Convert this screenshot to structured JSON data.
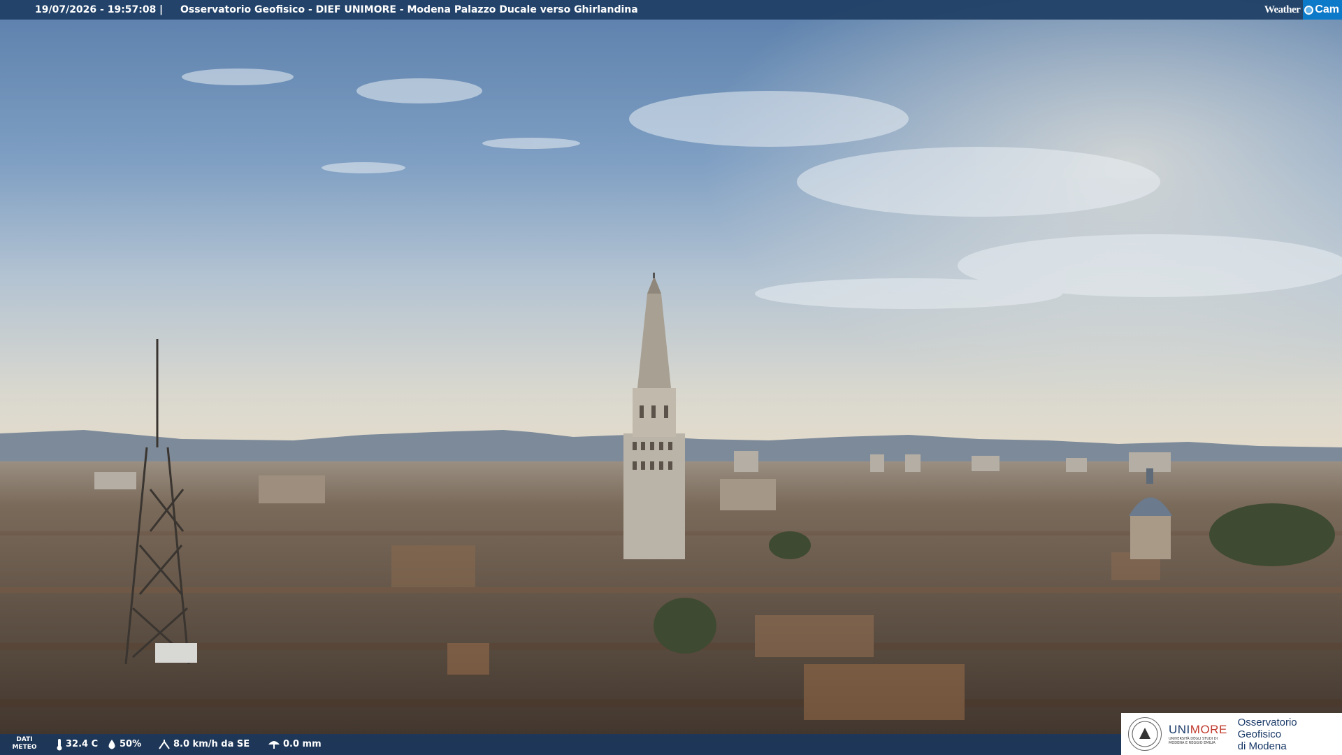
{
  "header": {
    "timestamp": "19/07/2026 - 19:57:08",
    "separator": "|",
    "title": "Osservatorio Geofisico - DIEF UNIMORE - Modena Palazzo Ducale verso Ghirlandina",
    "logo_word": "Weather",
    "logo_cam": "Cam"
  },
  "weather": {
    "label_line1": "DATI",
    "label_line2": "METEO",
    "temperature": "32.4 C",
    "humidity": "50%",
    "wind": "8.0 km/h da SE",
    "rain": "0.0 mm"
  },
  "footer_logo": {
    "brand_a": "UNI",
    "brand_b": "MORE",
    "brand_sub": "UNIVERSITÀ DEGLI STUDI DI MODENA E REGGIO EMILIA",
    "observatory_line1": "Osservatorio Geofisico",
    "observatory_line2": "di Modena"
  },
  "scene": {
    "subject": "view over Modena rooftops toward the Ghirlandina tower at sunset",
    "colors": {
      "sky_top": "#5a7fab",
      "sky_mid": "#9fb8d0",
      "sky_horizon": "#e2ddd0",
      "roofs": "#5a4a3e",
      "tower": "#b9b2a6",
      "bar": "#1e3e64"
    }
  }
}
